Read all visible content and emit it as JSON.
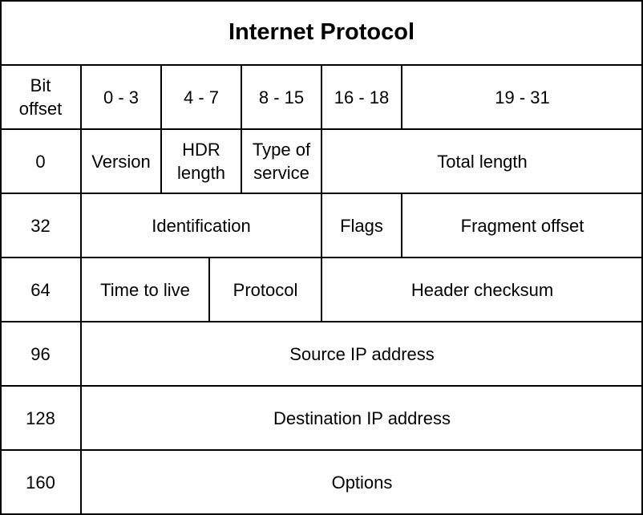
{
  "title": "Internet Protocol",
  "header": {
    "bit_offset": "Bit\noffset",
    "ranges": [
      "0 - 3",
      "4 - 7",
      "8 - 15",
      "16 - 18",
      "19 - 31"
    ]
  },
  "rows": [
    {
      "offset": "0",
      "fields": [
        "Version",
        "HDR\nlength",
        "Type of\nservice",
        "Total length"
      ]
    },
    {
      "offset": "32",
      "fields": [
        "Identification",
        "Flags",
        "Fragment offset"
      ]
    },
    {
      "offset": "64",
      "fields": [
        "Time to live",
        "Protocol",
        "Header checksum"
      ]
    },
    {
      "offset": "96",
      "fields": [
        "Source IP address"
      ]
    },
    {
      "offset": "128",
      "fields": [
        "Destination IP address"
      ]
    },
    {
      "offset": "160",
      "fields": [
        "Options"
      ]
    }
  ]
}
